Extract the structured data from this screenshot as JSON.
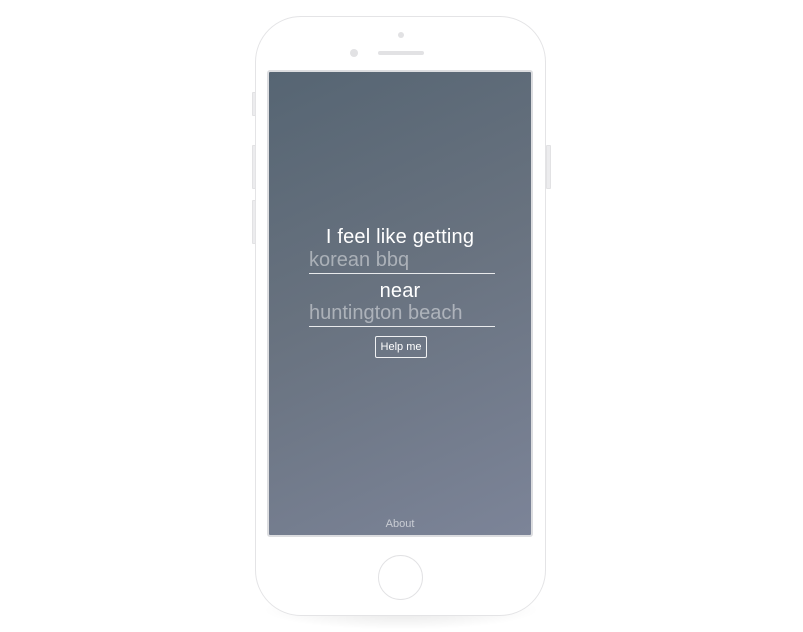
{
  "app": {
    "headline": "I feel like getting",
    "food_field": {
      "placeholder": "korean bbq",
      "value": ""
    },
    "connector": "near",
    "location_field": {
      "placeholder": "huntington beach",
      "value": ""
    },
    "submit_label": "Help me",
    "footer_link": "About"
  },
  "colors": {
    "gradient_start": "#566573",
    "gradient_end": "#7c8498",
    "text": "#ffffff",
    "device_frame": "#e4e4e6"
  },
  "icons": {
    "home_button": "home-button-icon",
    "camera": "front-camera-icon",
    "speaker": "earpiece-speaker-icon"
  }
}
